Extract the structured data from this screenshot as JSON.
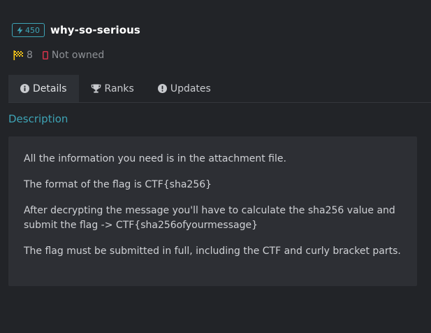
{
  "challenge": {
    "points": "450",
    "title": "why-so-serious",
    "solves": "8",
    "owned_status": "Not owned"
  },
  "tabs": [
    {
      "label": "Details",
      "icon": "info-circle-icon",
      "active": true
    },
    {
      "label": "Ranks",
      "icon": "trophy-icon",
      "active": false
    },
    {
      "label": "Updates",
      "icon": "exclamation-circle-icon",
      "active": false
    }
  ],
  "description": {
    "heading": "Description",
    "paragraphs": [
      "All the information you need is in the attachment file.",
      "The format of the flag is CTF{sha256}",
      "After decrypting the message you'll have to calculate the sha256 value and submit the flag -> CTF{sha256ofyourmessage}",
      "The flag must be submitted in full, including the CTF and curly bracket parts."
    ]
  },
  "colors": {
    "background": "#222428",
    "accent": "#3ea4b6",
    "card": "#2d2f34",
    "solves_flag": "#f5c518",
    "not_owned": "#d4334a"
  }
}
